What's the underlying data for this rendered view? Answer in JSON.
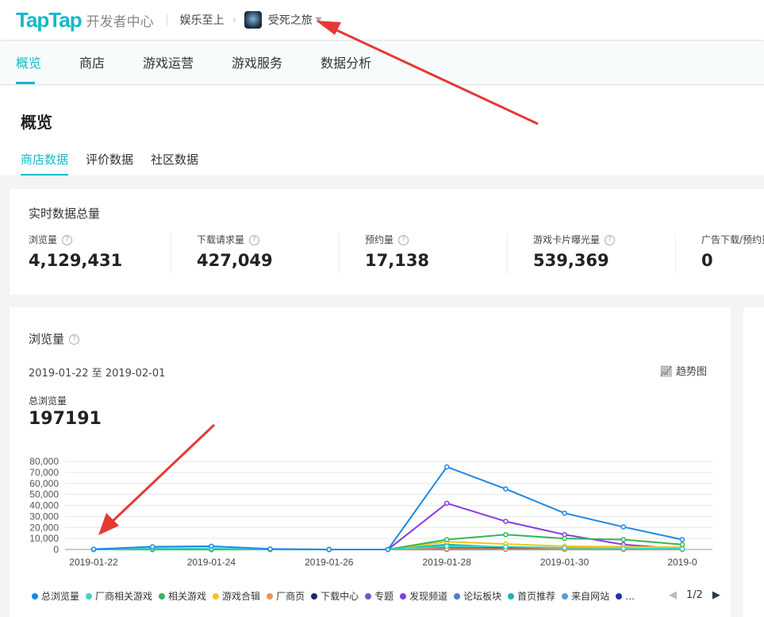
{
  "header": {
    "logo": "TapTap",
    "subtitle": "开发者中心",
    "breadcrumb_company": "娱乐至上",
    "breadcrumb_game": "受死之旅"
  },
  "nav": {
    "items": [
      "概览",
      "商店",
      "游戏运营",
      "游戏服务",
      "数据分析"
    ],
    "active": 0
  },
  "page": {
    "title": "概览",
    "subtabs": [
      "商店数据",
      "评价数据",
      "社区数据"
    ]
  },
  "realtime": {
    "title": "实时数据总量",
    "stats": [
      {
        "label": "浏览量",
        "value": "4,129,431"
      },
      {
        "label": "下载请求量",
        "value": "427,049"
      },
      {
        "label": "预约量",
        "value": "17,138"
      },
      {
        "label": "游戏卡片曝光量",
        "value": "539,369"
      },
      {
        "label": "广告下载/预约量",
        "value": "0"
      }
    ]
  },
  "views_card": {
    "title": "浏览量",
    "date_range": "2019-01-22 至 2019-02-01",
    "trend_label": "趋势图",
    "total_label": "总浏览量",
    "total_value": "197191",
    "pager": "1/2"
  },
  "chart_data": {
    "type": "line",
    "x": [
      "2019-01-22",
      "2019-01-23",
      "2019-01-24",
      "2019-01-25",
      "2019-01-26",
      "2019-01-27",
      "2019-01-28",
      "2019-01-29",
      "2019-01-30",
      "2019-01-31",
      "2019-02-01"
    ],
    "xtick_labels": [
      "2019-01-22",
      "2019-01-24",
      "2019-01-26",
      "2019-01-28",
      "2019-01-30",
      "2019-0"
    ],
    "ytick_labels": [
      "0",
      "10,000",
      "20,000",
      "30,000",
      "40,000",
      "50,000",
      "60,000",
      "70,000",
      "80,000"
    ],
    "ylim": [
      0,
      80000
    ],
    "grid": true,
    "legend_position": "bottom",
    "series": [
      {
        "name": "总浏览量",
        "color": "#1e88e5",
        "values": [
          300,
          2500,
          3000,
          500,
          0,
          0,
          75000,
          55000,
          33000,
          20500,
          9000
        ]
      },
      {
        "name": "厂商相关游戏",
        "color": "#3dd6c0",
        "values": [
          0,
          1000,
          1000,
          200,
          0,
          0,
          3000,
          2500,
          1500,
          1000,
          500
        ]
      },
      {
        "name": "相关游戏",
        "color": "#2eb85c",
        "values": [
          0,
          0,
          0,
          0,
          0,
          0,
          9000,
          13500,
          10000,
          9000,
          4500
        ]
      },
      {
        "name": "游戏合辑",
        "color": "#f5c518",
        "values": [
          0,
          0,
          0,
          0,
          0,
          0,
          7000,
          5000,
          3000,
          2500,
          2000
        ]
      },
      {
        "name": "厂商页",
        "color": "#e8935a",
        "values": [
          0,
          0,
          0,
          0,
          0,
          0,
          500,
          400,
          300,
          200,
          100
        ]
      },
      {
        "name": "下载中心",
        "color": "#1a2a6c",
        "values": [
          0,
          0,
          0,
          0,
          0,
          0,
          500,
          1500,
          1000,
          800,
          400
        ]
      },
      {
        "name": "专题",
        "color": "#6a5acd",
        "values": [
          0,
          0,
          0,
          0,
          0,
          0,
          1000,
          800,
          500,
          300,
          200
        ]
      },
      {
        "name": "发现频道",
        "color": "#8a3ee0",
        "values": [
          0,
          0,
          0,
          0,
          0,
          0,
          42000,
          25500,
          13500,
          4500,
          500
        ]
      },
      {
        "name": "论坛板块",
        "color": "#4a7fd6",
        "values": [
          0,
          0,
          0,
          0,
          0,
          0,
          1500,
          1000,
          600,
          400,
          200
        ]
      },
      {
        "name": "首页推荐",
        "color": "#17b3b3",
        "values": [
          0,
          0,
          0,
          0,
          0,
          0,
          4500,
          2000,
          1000,
          500,
          0
        ]
      },
      {
        "name": "来自网站",
        "color": "#5b9bd5",
        "values": [
          0,
          0,
          0,
          0,
          0,
          0,
          200,
          150,
          100,
          80,
          50
        ]
      },
      {
        "name": "…",
        "color": "#2233aa",
        "values": [
          0,
          0,
          0,
          0,
          0,
          0,
          100,
          80,
          60,
          40,
          20
        ]
      }
    ]
  }
}
